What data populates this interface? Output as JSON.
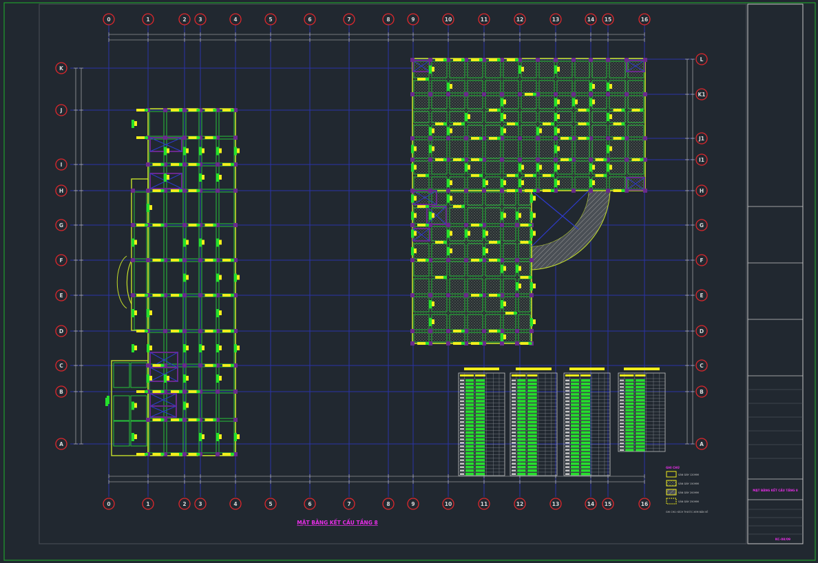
{
  "grid": {
    "top_labels": [
      "0",
      "1",
      "2",
      "3",
      "4",
      "5",
      "6",
      "7",
      "8",
      "9",
      "10",
      "11",
      "12",
      "13",
      "14",
      "15",
      "16"
    ],
    "bottom_labels": [
      "0",
      "1",
      "2",
      "3",
      "4",
      "5",
      "6",
      "7",
      "8",
      "9",
      "10",
      "11",
      "12",
      "13",
      "14",
      "15",
      "16"
    ],
    "left_labels": [
      "K",
      "J",
      "I",
      "H",
      "G",
      "F",
      "E",
      "D",
      "C",
      "B",
      "A"
    ],
    "right_labels": [
      "L",
      "K1",
      "J1",
      "I1",
      "H",
      "G",
      "F",
      "E",
      "D",
      "C",
      "B",
      "A"
    ]
  },
  "title_block": {
    "sheet_name": "MẶT BẰNG KẾT CẤU TẦNG 8",
    "sheet_code": "KC-08/09"
  },
  "legend": {
    "title": "GHI CHÚ",
    "items": [
      "SÀN DÀY 120MM",
      "SÀN DÀY 150MM",
      "SÀN DÀY 200MM",
      "SÀN DÀY 250MM"
    ],
    "note": "GHI CHÚ: KÍCH THƯỚC XEM BẢN VẼ"
  },
  "drawing_title": "MẶT BẰNG KẾT CẤU TẦNG 8",
  "colors": {
    "background": "#212830",
    "grid_line": "#2a33a8",
    "bubble": "#e0272c",
    "frame": "#1f9e2c",
    "beam": "#27c43a",
    "wall": "#c6e02a",
    "column": "#6a2a8c",
    "marker_yellow": "#f2ee1b",
    "marker_green": "#25e02c",
    "title_magenta": "#e62ee6",
    "dimension": "#c9c9c9",
    "hatch_stair": "#8e8e8e"
  }
}
